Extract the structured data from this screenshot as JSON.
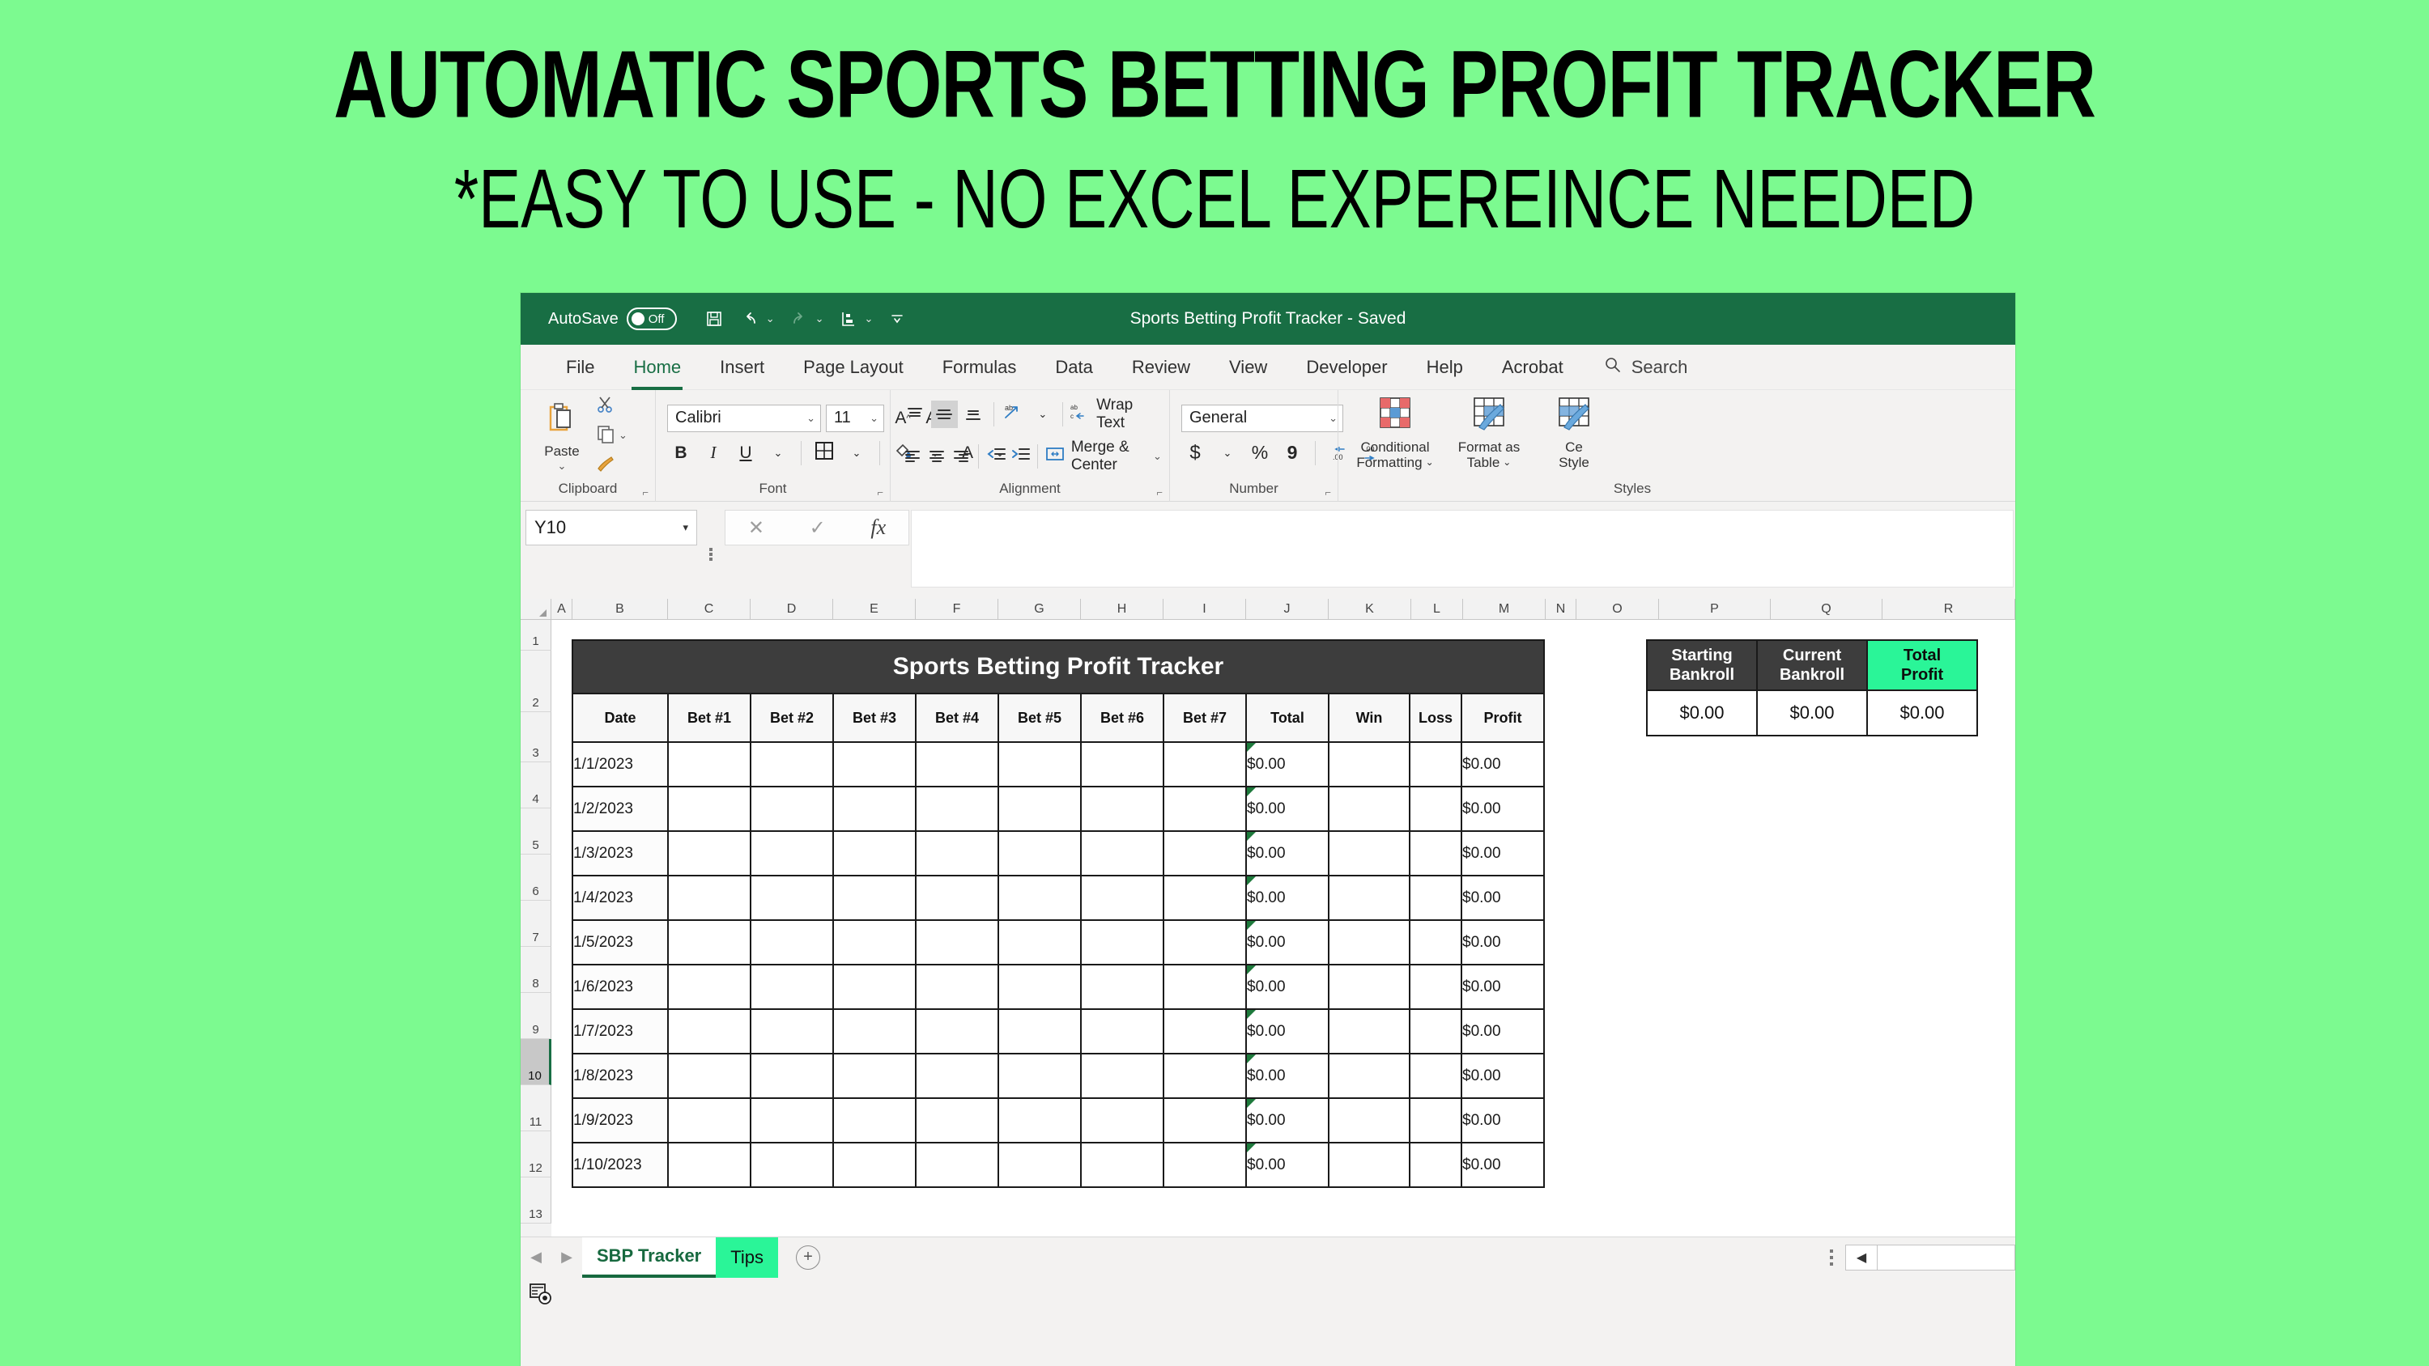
{
  "promo": {
    "title": "AUTOMATIC SPORTS BETTING PROFIT TRACKER",
    "subtitle": "*EASY TO USE - NO EXCEL EXPEREINCE NEEDED"
  },
  "titlebar": {
    "autosave_label": "AutoSave",
    "autosave_state": "Off",
    "document_title": "Sports Betting Profit Tracker  -  Saved",
    "quick_access": [
      "save-icon",
      "undo-icon",
      "redo-icon",
      "customize-icon",
      "more-icon"
    ]
  },
  "ribbon": {
    "tabs": [
      {
        "label": "File",
        "active": false
      },
      {
        "label": "Home",
        "active": true
      },
      {
        "label": "Insert",
        "active": false
      },
      {
        "label": "Page Layout",
        "active": false
      },
      {
        "label": "Formulas",
        "active": false
      },
      {
        "label": "Data",
        "active": false
      },
      {
        "label": "Review",
        "active": false
      },
      {
        "label": "View",
        "active": false
      },
      {
        "label": "Developer",
        "active": false
      },
      {
        "label": "Help",
        "active": false
      },
      {
        "label": "Acrobat",
        "active": false
      }
    ],
    "search_label": "Search",
    "groups": {
      "clipboard": {
        "label": "Clipboard",
        "paste_label": "Paste",
        "cut_icon": "scissors-icon",
        "copy_icon": "copy-icon",
        "format_painter_icon": "format-painter-icon"
      },
      "font": {
        "label": "Font",
        "font_name": "Calibri",
        "font_size": "11",
        "bold": "B",
        "italic": "I",
        "underline": "U",
        "grow_font": "A",
        "shrink_font": "A",
        "borders_icon": "borders-icon",
        "fill_color_icon": "fill-color-icon",
        "font_color": "A"
      },
      "alignment": {
        "label": "Alignment",
        "wrap_text": "Wrap Text",
        "merge_center": "Merge & Center",
        "orientation_icon": "orientation-icon",
        "decrease_indent_icon": "decrease-indent-icon",
        "increase_indent_icon": "increase-indent-icon"
      },
      "number": {
        "label": "Number",
        "format": "General",
        "accounting": "$",
        "percent": "%",
        "comma": "9",
        "decrease_decimal": ".00",
        "increase_decimal": ".00"
      },
      "styles": {
        "label": "Styles",
        "conditional_formatting": "Conditional Formatting",
        "format_as_table": "Format as Table",
        "cell_styles": "Cell Styles"
      }
    }
  },
  "formula_bar": {
    "name_box": "Y10",
    "cancel_icon": "cancel-icon",
    "enter_icon": "enter-icon",
    "function_icon": "fx-icon",
    "value": ""
  },
  "grid": {
    "columns": [
      "A",
      "B",
      "C",
      "D",
      "E",
      "F",
      "G",
      "H",
      "I",
      "J",
      "K",
      "L",
      "M",
      "N",
      "O",
      "P",
      "Q",
      "R"
    ],
    "rows": [
      "1",
      "2",
      "3",
      "4",
      "5",
      "6",
      "7",
      "8",
      "9",
      "10",
      "11",
      "12",
      "13"
    ],
    "selected_row": "10"
  },
  "tracker": {
    "title": "Sports Betting Profit Tracker",
    "headers": [
      "Date",
      "Bet #1",
      "Bet #2",
      "Bet #3",
      "Bet #4",
      "Bet #5",
      "Bet #6",
      "Bet #7",
      "Total",
      "Win",
      "Loss",
      "Profit"
    ],
    "rows": [
      {
        "date": "1/1/2023",
        "total": "$0.00",
        "win": "",
        "loss": "",
        "profit": "$0.00"
      },
      {
        "date": "1/2/2023",
        "total": "$0.00",
        "win": "",
        "loss": "",
        "profit": "$0.00"
      },
      {
        "date": "1/3/2023",
        "total": "$0.00",
        "win": "",
        "loss": "",
        "profit": "$0.00"
      },
      {
        "date": "1/4/2023",
        "total": "$0.00",
        "win": "",
        "loss": "",
        "profit": "$0.00"
      },
      {
        "date": "1/5/2023",
        "total": "$0.00",
        "win": "",
        "loss": "",
        "profit": "$0.00"
      },
      {
        "date": "1/6/2023",
        "total": "$0.00",
        "win": "",
        "loss": "",
        "profit": "$0.00"
      },
      {
        "date": "1/7/2023",
        "total": "$0.00",
        "win": "",
        "loss": "",
        "profit": "$0.00"
      },
      {
        "date": "1/8/2023",
        "total": "$0.00",
        "win": "",
        "loss": "",
        "profit": "$0.00"
      },
      {
        "date": "1/9/2023",
        "total": "$0.00",
        "win": "",
        "loss": "",
        "profit": "$0.00"
      },
      {
        "date": "1/10/2023",
        "total": "$0.00",
        "win": "",
        "loss": "",
        "profit": "$0.00"
      }
    ]
  },
  "summary": {
    "headers": [
      "Starting Bankroll",
      "Current Bankroll",
      "Total Profit"
    ],
    "header_lines": [
      [
        "Starting",
        "Bankroll"
      ],
      [
        "Current",
        "Bankroll"
      ],
      [
        "Total",
        "Profit"
      ]
    ],
    "values": [
      "$0.00",
      "$0.00",
      "$0.00"
    ]
  },
  "sheet_tabs": {
    "prev_icon": "prev-sheet-icon",
    "next_icon": "next-sheet-icon",
    "tabs": [
      {
        "label": "SBP Tracker",
        "active": true
      },
      {
        "label": "Tips",
        "active": false
      }
    ],
    "add_label": "+"
  },
  "status_bar": {
    "recording_macro_icon": "record-macro-icon"
  },
  "colors": {
    "background_green": "#7CFA90",
    "excel_green": "#186e44",
    "accent_green": "#2af598",
    "table_header_dark": "#3d3d3d"
  }
}
